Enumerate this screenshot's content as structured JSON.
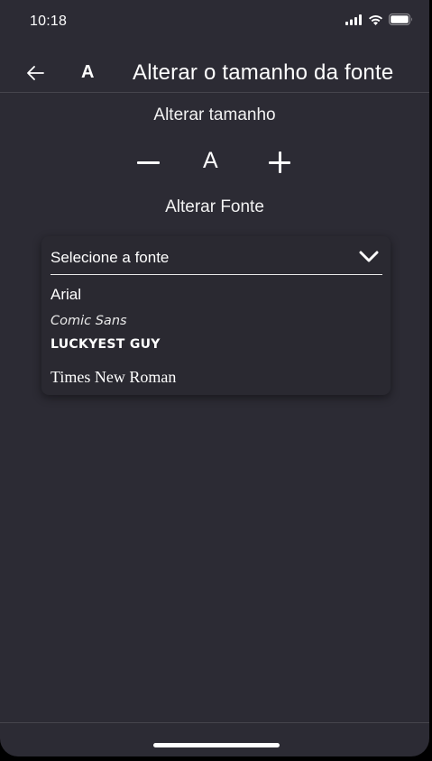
{
  "status_bar": {
    "time": "10:18",
    "icons": [
      "signal-icon",
      "wifi-icon",
      "battery-icon"
    ]
  },
  "header": {
    "back_icon": "arrow-left-icon",
    "font_icon": "A",
    "title": "Alterar o tamanho da fonte"
  },
  "size_section": {
    "label": "Alterar tamanho",
    "decrease_icon": "minus-icon",
    "preview": "A",
    "increase_icon": "plus-icon"
  },
  "font_section": {
    "label": "Alterar Fonte",
    "dropdown": {
      "selected": "Selecione a fonte",
      "chevron_icon": "chevron-down-icon",
      "options": [
        "Arial",
        "Comic Sans",
        "LUCKYEST GUY",
        "Times New Roman"
      ]
    }
  },
  "colors": {
    "background": "#2c2b34",
    "dropdown_background": "#2a2931",
    "text": "#ffffff"
  }
}
